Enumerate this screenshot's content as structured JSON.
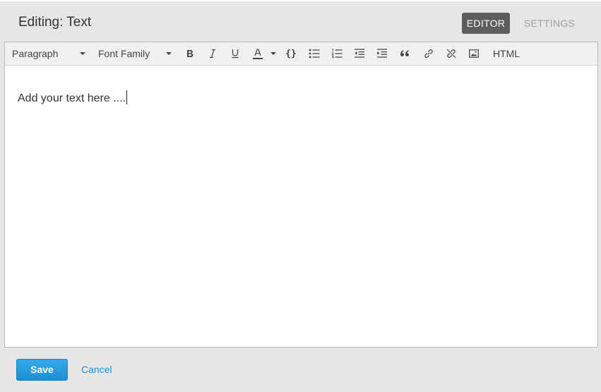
{
  "dialog": {
    "title": "Editing: Text"
  },
  "tabs": [
    {
      "label": "EDITOR",
      "active": true
    },
    {
      "label": "SETTINGS",
      "active": false
    }
  ],
  "toolbar": {
    "format_select": "Paragraph",
    "font_select": "Font Family",
    "code_label": "{}",
    "html_label": "HTML",
    "icons": [
      "bold-icon",
      "italic-icon",
      "underline-icon",
      "text-color-icon",
      "code-icon",
      "bullet-list-icon",
      "numbered-list-icon",
      "outdent-icon",
      "indent-icon",
      "blockquote-icon",
      "link-icon",
      "unlink-icon",
      "image-icon"
    ]
  },
  "editor": {
    "content": "Add your text here ...."
  },
  "footer": {
    "save_label": "Save",
    "cancel_label": "Cancel"
  },
  "colors": {
    "accent": "#1c8fd2",
    "active_tab": "#5d5d5d",
    "link": "#2a8fd0"
  }
}
